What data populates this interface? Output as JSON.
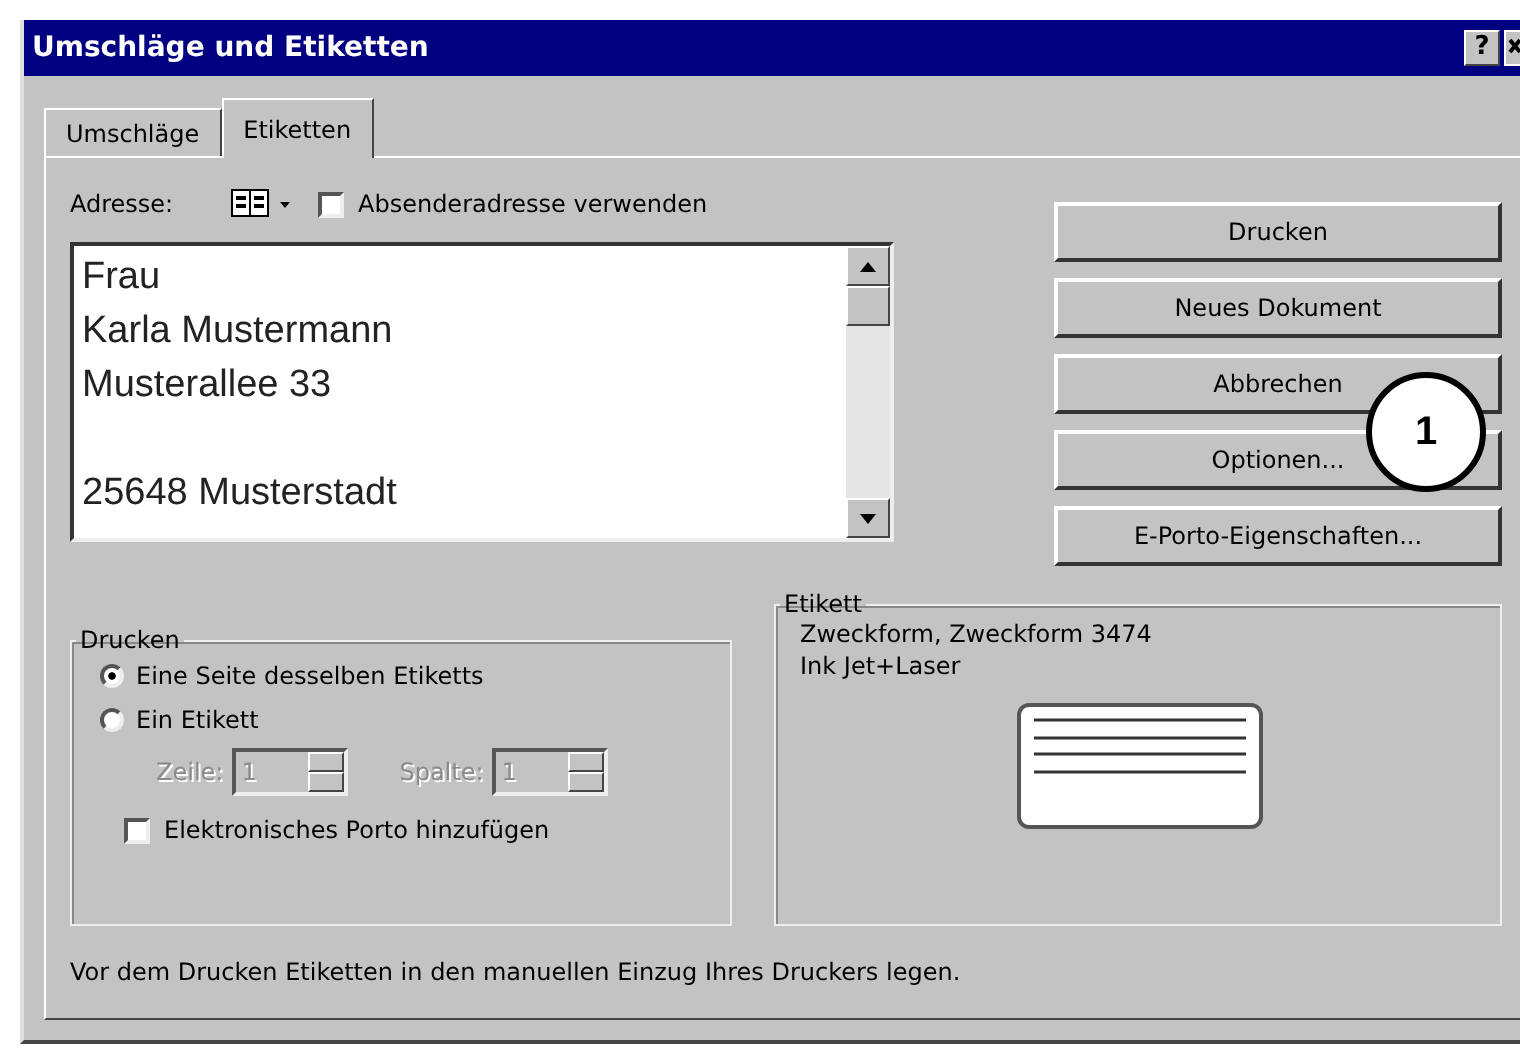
{
  "window": {
    "title": "Umschläge und Etiketten",
    "help_button": "?"
  },
  "tabs": [
    {
      "label": "Umschläge",
      "selected": false
    },
    {
      "label": "Etiketten",
      "selected": true
    }
  ],
  "address": {
    "label": "Adresse:",
    "sender_checkbox": {
      "label": "Absenderadresse verwenden",
      "checked": false
    },
    "line_blocks": [
      [
        "Frau",
        "Karla Mustermann",
        "Musterallee 33"
      ],
      [
        "25648 Musterstadt"
      ]
    ]
  },
  "buttons": [
    "Drucken",
    "Neues Dokument",
    "Abbrechen",
    "Optionen...",
    "E-Porto-Eigenschaften..."
  ],
  "callout": {
    "label": "1"
  },
  "print_group": {
    "title": "Drucken",
    "options": [
      {
        "label": "Eine Seite desselben Etiketts",
        "selected": true
      },
      {
        "label": "Ein Etikett",
        "selected": false
      }
    ],
    "spinners": [
      {
        "label": "Zeile:",
        "value": "1",
        "disabled": true
      },
      {
        "label": "Spalte:",
        "value": "1",
        "disabled": true
      }
    ],
    "postage_checkbox": {
      "label": "Elektronisches Porto hinzufügen",
      "checked": false
    }
  },
  "label_group": {
    "title": "Etikett",
    "lines": [
      "Zweckform, Zweckform 3474",
      "Ink Jet+Laser"
    ]
  },
  "footer_note": "Vor dem Drucken Etiketten in den manuellen Einzug Ihres Druckers legen."
}
